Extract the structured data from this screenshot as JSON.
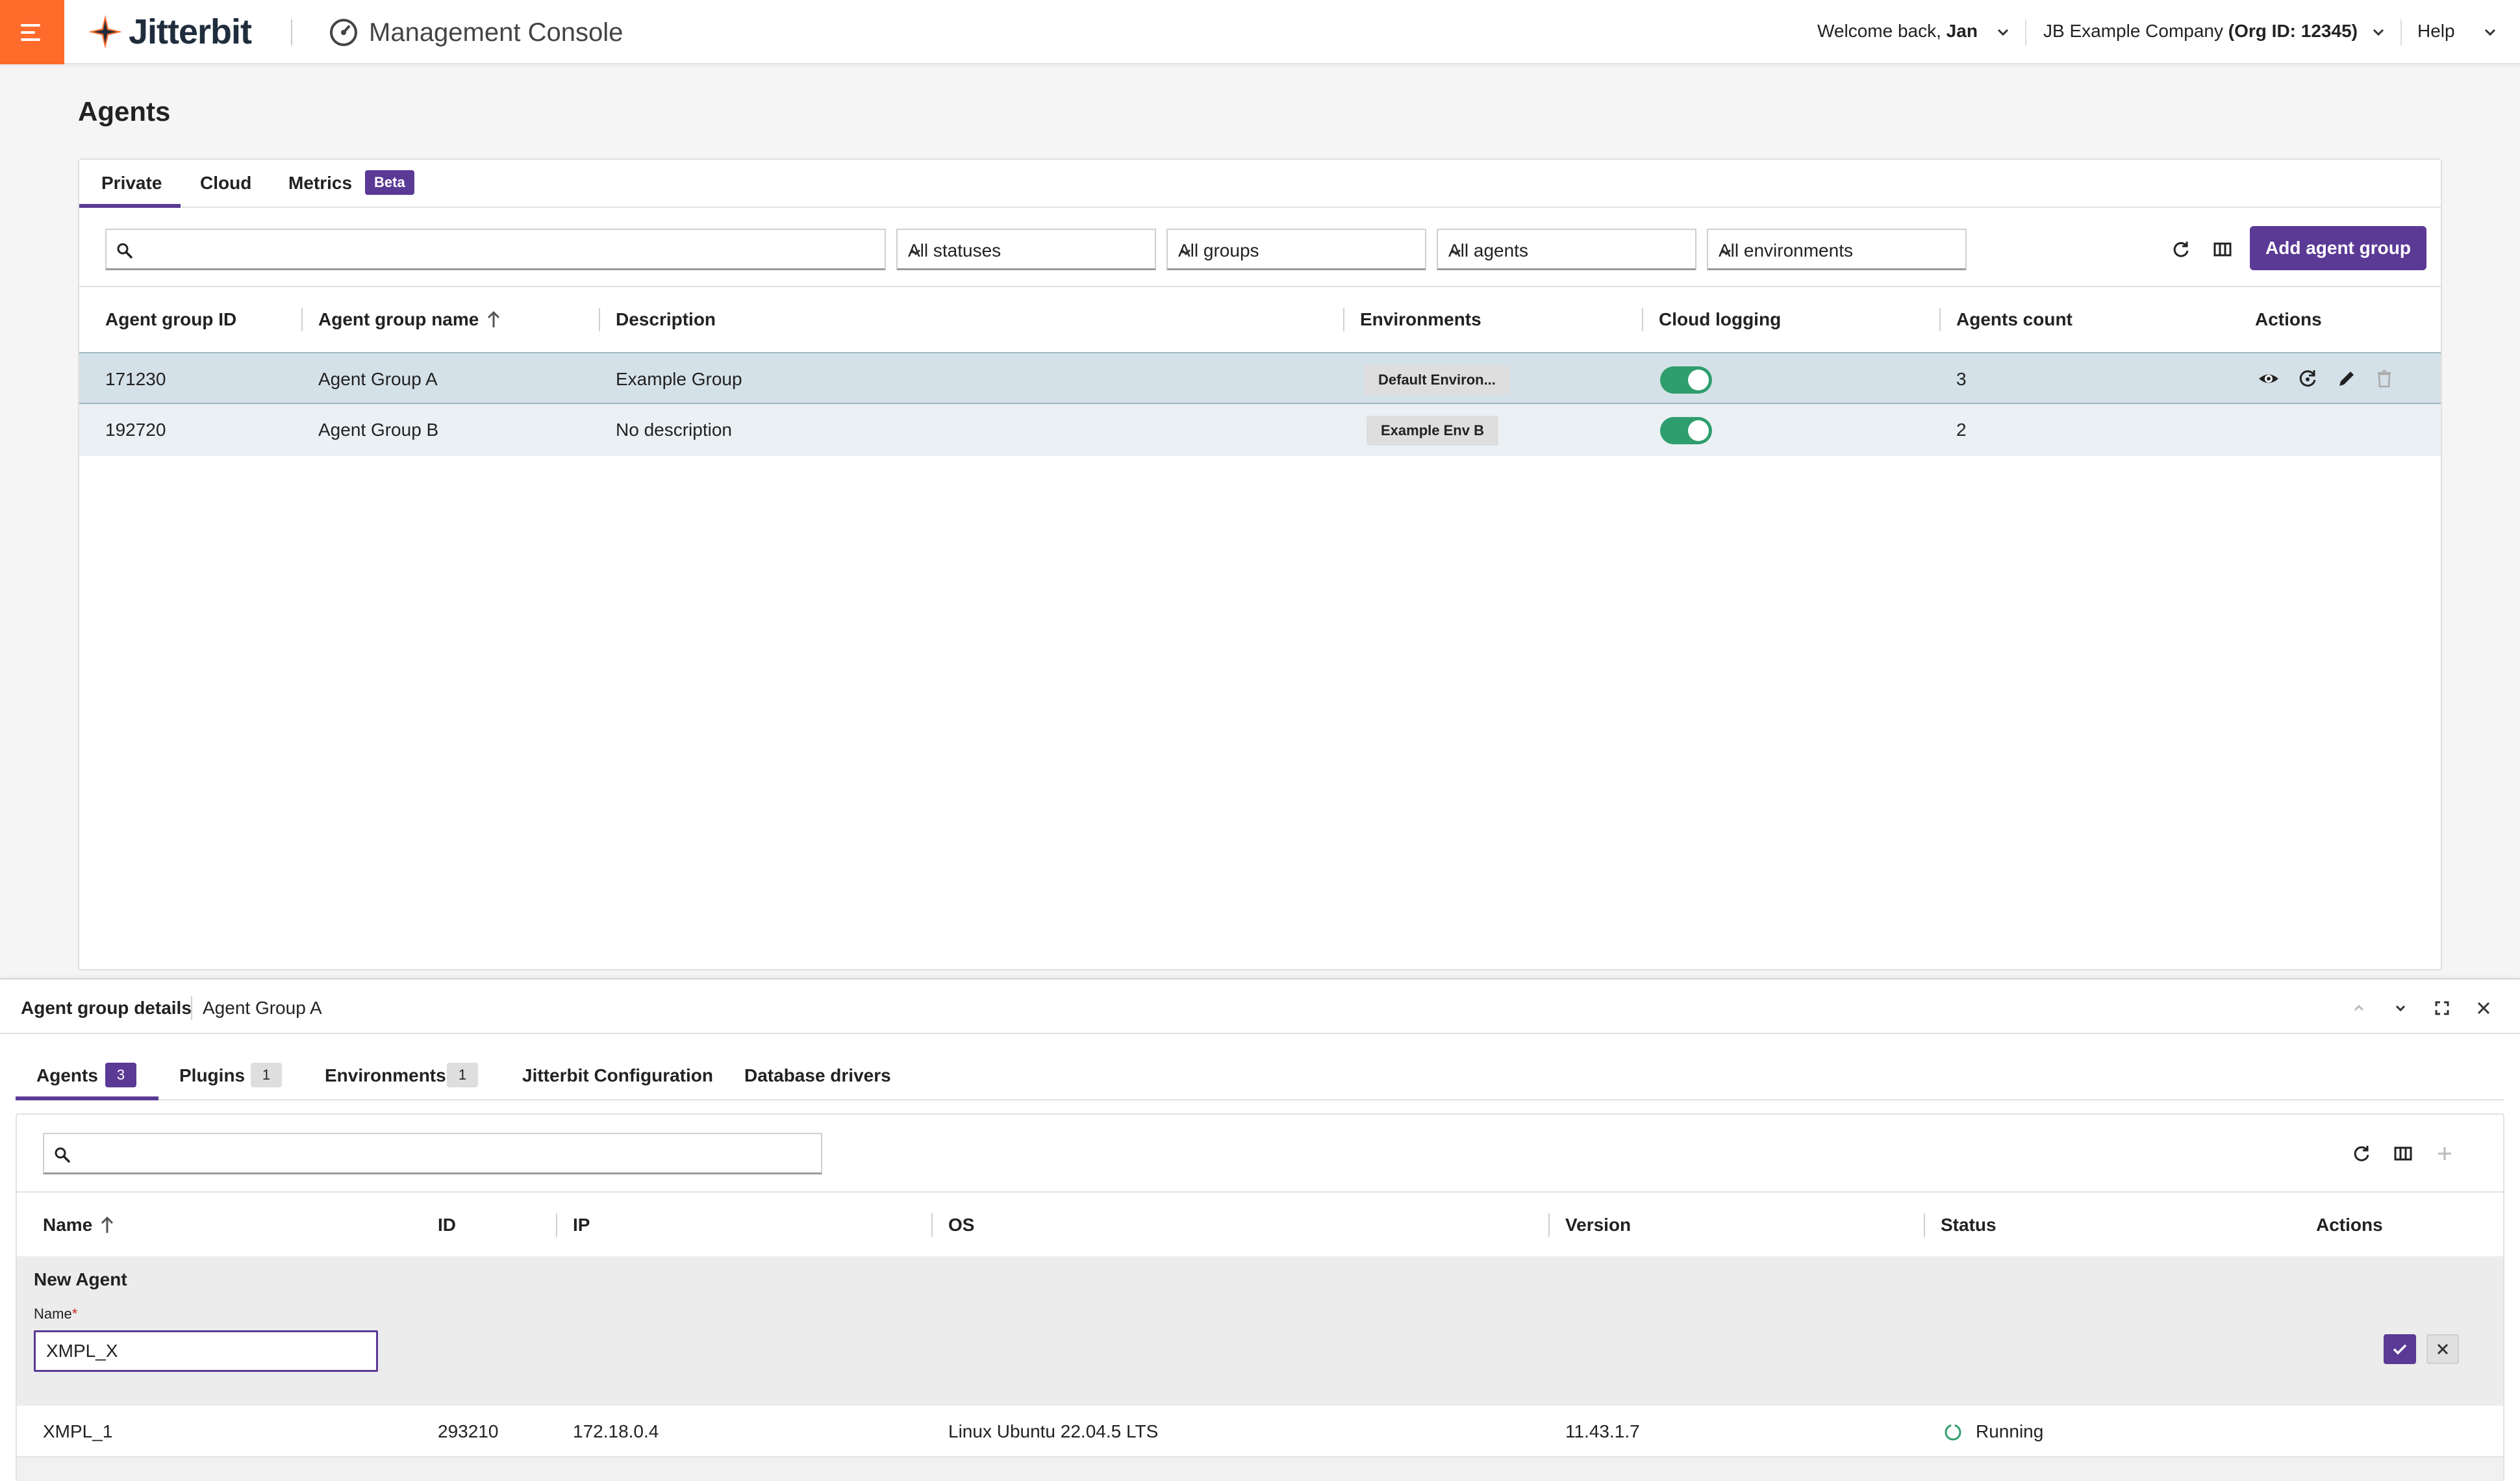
{
  "header": {
    "brand": "Jitterbit",
    "app_title": "Management Console",
    "welcome_prefix": "Welcome back,",
    "user_name": "Jan",
    "company_name": "JB Example Company",
    "org_id": "(Org ID: 12345)",
    "help": "Help"
  },
  "page": {
    "title": "Agents"
  },
  "tabs": [
    {
      "label": "Private",
      "active": true
    },
    {
      "label": "Cloud"
    },
    {
      "label": "Metrics",
      "badge": "Beta"
    }
  ],
  "filters": {
    "search_placeholder": "",
    "status": "All statuses",
    "groups": "All groups",
    "agents": "All agents",
    "environments": "All environments",
    "add_button": "Add agent group"
  },
  "groups_table": {
    "columns": [
      "Agent group ID",
      "Agent group name",
      "Description",
      "Environments",
      "Cloud logging",
      "Agents count",
      "Actions"
    ],
    "rows": [
      {
        "id": "171230",
        "name": "Agent Group A",
        "description": "Example Group",
        "environment": "Default Environ...",
        "cloud_logging": true,
        "agents_count": "3",
        "selected": true
      },
      {
        "id": "192720",
        "name": "Agent Group B",
        "description": "No description",
        "environment": "Example Env B",
        "cloud_logging": true,
        "agents_count": "2"
      }
    ]
  },
  "details": {
    "title": "Agent group details",
    "group_name": "Agent Group A",
    "tabs": [
      {
        "label": "Agents",
        "count": "3",
        "active": true
      },
      {
        "label": "Plugins",
        "count": "1"
      },
      {
        "label": "Environments",
        "count": "1"
      },
      {
        "label": "Jitterbit Configuration"
      },
      {
        "label": "Database drivers"
      }
    ],
    "columns": [
      "Name",
      "ID",
      "IP",
      "OS",
      "Version",
      "Status",
      "Actions"
    ],
    "new_agent": {
      "title": "New Agent",
      "name_label": "Name",
      "required_mark": "*",
      "name_value": "XMPL_X"
    },
    "agents": [
      {
        "name": "XMPL_1",
        "id": "293210",
        "ip": "172.18.0.4",
        "os": "Linux Ubuntu 22.04.5 LTS",
        "version": "11.43.1.7",
        "status": "Running"
      }
    ]
  },
  "colors": {
    "accent": "#5b3a96",
    "menu_orange": "#ff6b2b",
    "toggle_on": "#2f9e6e",
    "selected_row": "#d5e1e8",
    "status_running": "#2f9e6e"
  }
}
